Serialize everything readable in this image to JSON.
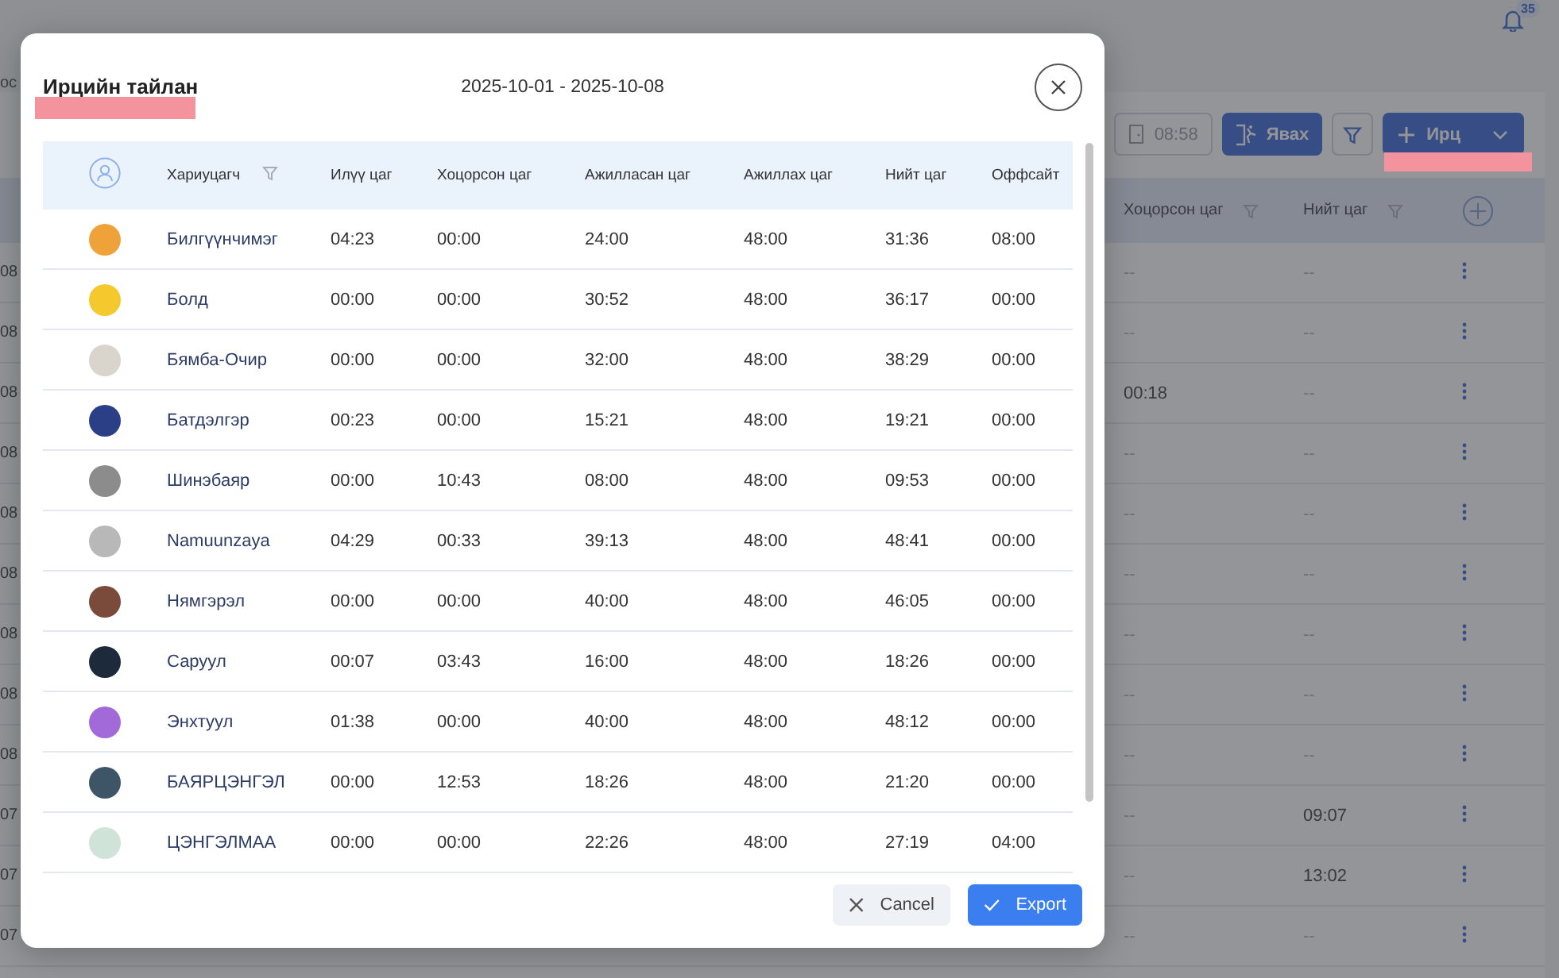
{
  "background": {
    "section_label": "ос",
    "notifications": {
      "count": "35"
    },
    "toolbar": {
      "timer": "08:58",
      "leave_button": "Явах",
      "add_button": "Ирц"
    },
    "table": {
      "columns": [
        {
          "label": "Хоцорсон цаг",
          "filterable": true
        },
        {
          "label": "Нийт цаг",
          "filterable": true
        }
      ],
      "rows": [
        {
          "date_fragment": "08",
          "late": "--",
          "total": "--"
        },
        {
          "date_fragment": "08",
          "late": "--",
          "total": "--"
        },
        {
          "date_fragment": "08",
          "late": "00:18",
          "total": "--"
        },
        {
          "date_fragment": "08",
          "late": "--",
          "total": "--"
        },
        {
          "date_fragment": "08",
          "late": "--",
          "total": "--"
        },
        {
          "date_fragment": "08",
          "late": "--",
          "total": "--"
        },
        {
          "date_fragment": "08",
          "late": "--",
          "total": "--"
        },
        {
          "date_fragment": "08",
          "late": "--",
          "total": "--"
        },
        {
          "date_fragment": "08",
          "late": "--",
          "total": "--"
        },
        {
          "date_fragment": "07",
          "late": "--",
          "total": "09:07"
        },
        {
          "date_fragment": "07",
          "late": "--",
          "total": "13:02"
        },
        {
          "date_fragment": "07",
          "late": "--",
          "total": "--"
        }
      ]
    }
  },
  "modal": {
    "title": "Ирцийн тайлан",
    "date_range": "2025-10-01 - 2025-10-08",
    "table": {
      "columns": [
        {
          "label": "Хариуцагч",
          "filterable": true
        },
        {
          "label": "Илүү цаг",
          "filterable": false
        },
        {
          "label": "Хоцорсон цаг",
          "filterable": false
        },
        {
          "label": "Ажилласан цаг",
          "filterable": false
        },
        {
          "label": "Ажиллах цаг",
          "filterable": false
        },
        {
          "label": "Нийт цаг",
          "filterable": false
        },
        {
          "label": "Оффсайт",
          "filterable": false
        }
      ],
      "rows": [
        {
          "name": "Билгүүнчимэг",
          "color": "#f0a23a",
          "values": [
            "04:23",
            "00:00",
            "24:00",
            "48:00",
            "31:36",
            "08:00"
          ]
        },
        {
          "name": "Болд",
          "color": "#f5c92e",
          "values": [
            "00:00",
            "00:00",
            "30:52",
            "48:00",
            "36:17",
            "00:00"
          ]
        },
        {
          "name": "Бямба-Очир",
          "color": "#d9d4cc",
          "values": [
            "00:00",
            "00:00",
            "32:00",
            "48:00",
            "38:29",
            "00:00"
          ]
        },
        {
          "name": "Батдэлгэр",
          "color": "#2b3f86",
          "values": [
            "00:23",
            "00:00",
            "15:21",
            "48:00",
            "19:21",
            "00:00"
          ]
        },
        {
          "name": "Шинэбаяр",
          "color": "#8c8c8c",
          "values": [
            "00:00",
            "10:43",
            "08:00",
            "48:00",
            "09:53",
            "00:00"
          ]
        },
        {
          "name": "Namuunzaya",
          "color": "#b8b8b8",
          "values": [
            "04:29",
            "00:33",
            "39:13",
            "48:00",
            "48:41",
            "00:00"
          ]
        },
        {
          "name": "Нямгэрэл",
          "color": "#7a4a3a",
          "values": [
            "00:00",
            "00:00",
            "40:00",
            "48:00",
            "46:05",
            "00:00"
          ]
        },
        {
          "name": "Саруул",
          "color": "#1d2a3c",
          "values": [
            "00:07",
            "03:43",
            "16:00",
            "48:00",
            "18:26",
            "00:00"
          ]
        },
        {
          "name": "Энхтуул",
          "color": "#a26ad8",
          "values": [
            "01:38",
            "00:00",
            "40:00",
            "48:00",
            "48:12",
            "00:00"
          ]
        },
        {
          "name": "БАЯРЦЭНГЭЛ",
          "color": "#3d5566",
          "values": [
            "00:00",
            "12:53",
            "18:26",
            "48:00",
            "21:20",
            "00:00"
          ]
        },
        {
          "name": "ЦЭНГЭЛМАА",
          "color": "#cfe3d9",
          "values": [
            "00:00",
            "00:00",
            "22:26",
            "48:00",
            "27:19",
            "04:00"
          ]
        }
      ]
    },
    "buttons": {
      "cancel": "Cancel",
      "export": "Export"
    }
  }
}
